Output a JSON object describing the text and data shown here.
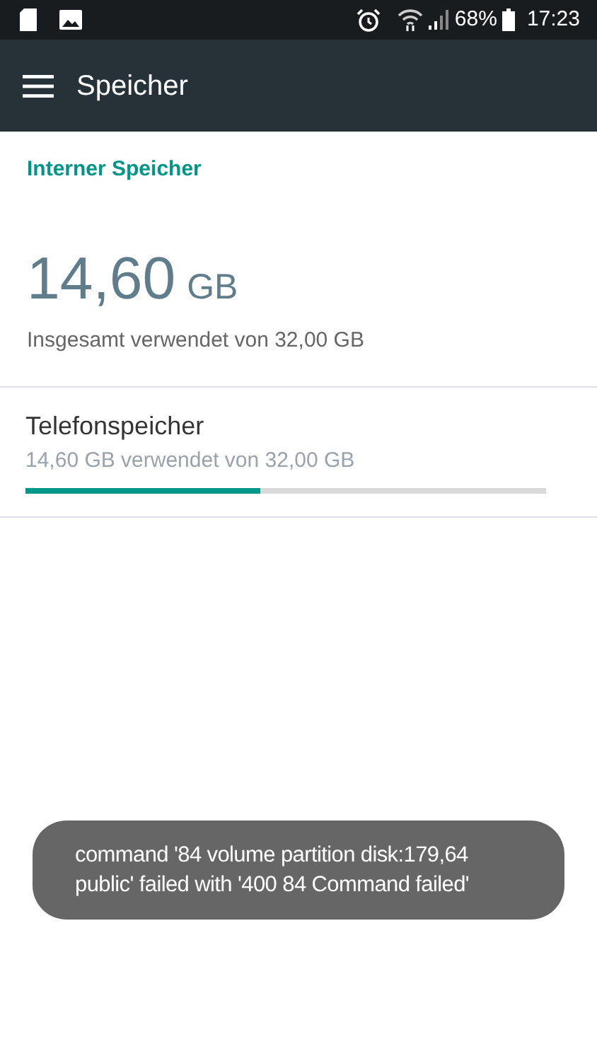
{
  "status_bar": {
    "battery": "68%",
    "time": "17:23"
  },
  "app_bar": {
    "title": "Speicher"
  },
  "section": {
    "title": "Interner Speicher"
  },
  "summary": {
    "amount": "14,60",
    "unit": "GB",
    "caption": "Insgesamt verwendet von 32,00 GB"
  },
  "volumes": [
    {
      "name": "Telefonspeicher",
      "usage": "14,60 GB verwendet von 32,00 GB",
      "level": 0.45
    }
  ],
  "toast": {
    "message": "command '84 volume partition disk:179,64 public' failed with '400 84 Command failed'"
  }
}
